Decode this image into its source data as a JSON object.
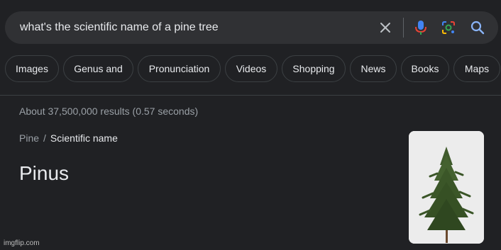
{
  "search": {
    "query": "what's the scientific name of a pine tree"
  },
  "chips": [
    "Images",
    "Genus and",
    "Pronunciation",
    "Videos",
    "Shopping",
    "News",
    "Books",
    "Maps"
  ],
  "results": {
    "stats": "About 37,500,000 results (0.57 seconds)"
  },
  "breadcrumb": {
    "parent": "Pine",
    "separator": "/",
    "current": "Scientific name"
  },
  "answer": {
    "text": "Pinus"
  },
  "thumbnail": {
    "icon": "pine-tree-image"
  },
  "watermark": "imgflip.com",
  "colors": {
    "background": "#202124",
    "searchbar": "#303134",
    "text_primary": "#e8eaed",
    "text_secondary": "#9aa0a6"
  }
}
